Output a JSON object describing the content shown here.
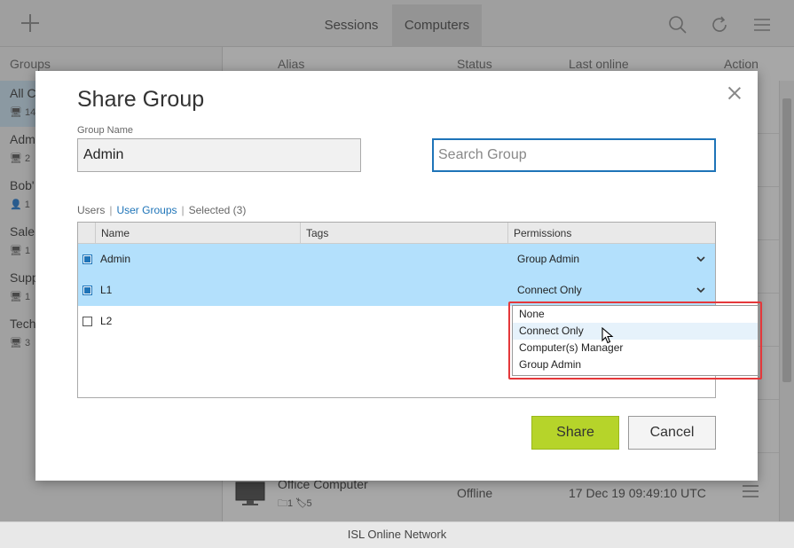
{
  "topbar": {
    "tabs": [
      {
        "label": "Sessions"
      },
      {
        "label": "Computers"
      }
    ]
  },
  "columns": {
    "groups": "Groups",
    "alias": "Alias",
    "status": "Status",
    "last_online": "Last online",
    "action": "Action"
  },
  "groups": [
    {
      "name": "All C",
      "count": "14"
    },
    {
      "name": "Adm",
      "count": "2"
    },
    {
      "name": "Bob'",
      "count": "1"
    },
    {
      "name": "Sale",
      "count": "1"
    },
    {
      "name": "Supp",
      "count": "1"
    },
    {
      "name": "Tech",
      "count": "3"
    }
  ],
  "computer_row": {
    "alias": "Office Computer",
    "folders": "1",
    "tags": "5",
    "status": "Offline",
    "last_online": "17 Dec 19 09:49:10 UTC"
  },
  "footer": {
    "text": "ISL Online Network"
  },
  "modal": {
    "title": "Share Group",
    "group_name_label": "Group Name",
    "group_name_value": "Admin",
    "search_placeholder": "Search Group",
    "filters": {
      "users": "Users",
      "user_groups": "User Groups",
      "selected": "Selected (3)"
    },
    "table": {
      "headers": {
        "name": "Name",
        "tags": "Tags",
        "permissions": "Permissions"
      },
      "rows": [
        {
          "name": "Admin",
          "tags": "",
          "permission": "Group Admin",
          "checked": true
        },
        {
          "name": "L1",
          "tags": "",
          "permission": "Connect Only",
          "checked": true
        },
        {
          "name": "L2",
          "tags": "",
          "permission": "",
          "checked": false
        }
      ]
    },
    "dropdown_options": [
      "None",
      "Connect Only",
      "Computer(s) Manager",
      "Group Admin"
    ],
    "share_label": "Share",
    "cancel_label": "Cancel"
  },
  "colors": {
    "accent_blue": "#1e74b8",
    "selected_row": "#b3e0fc",
    "share_button": "#b6d42a",
    "highlight_red": "#e5383b"
  }
}
